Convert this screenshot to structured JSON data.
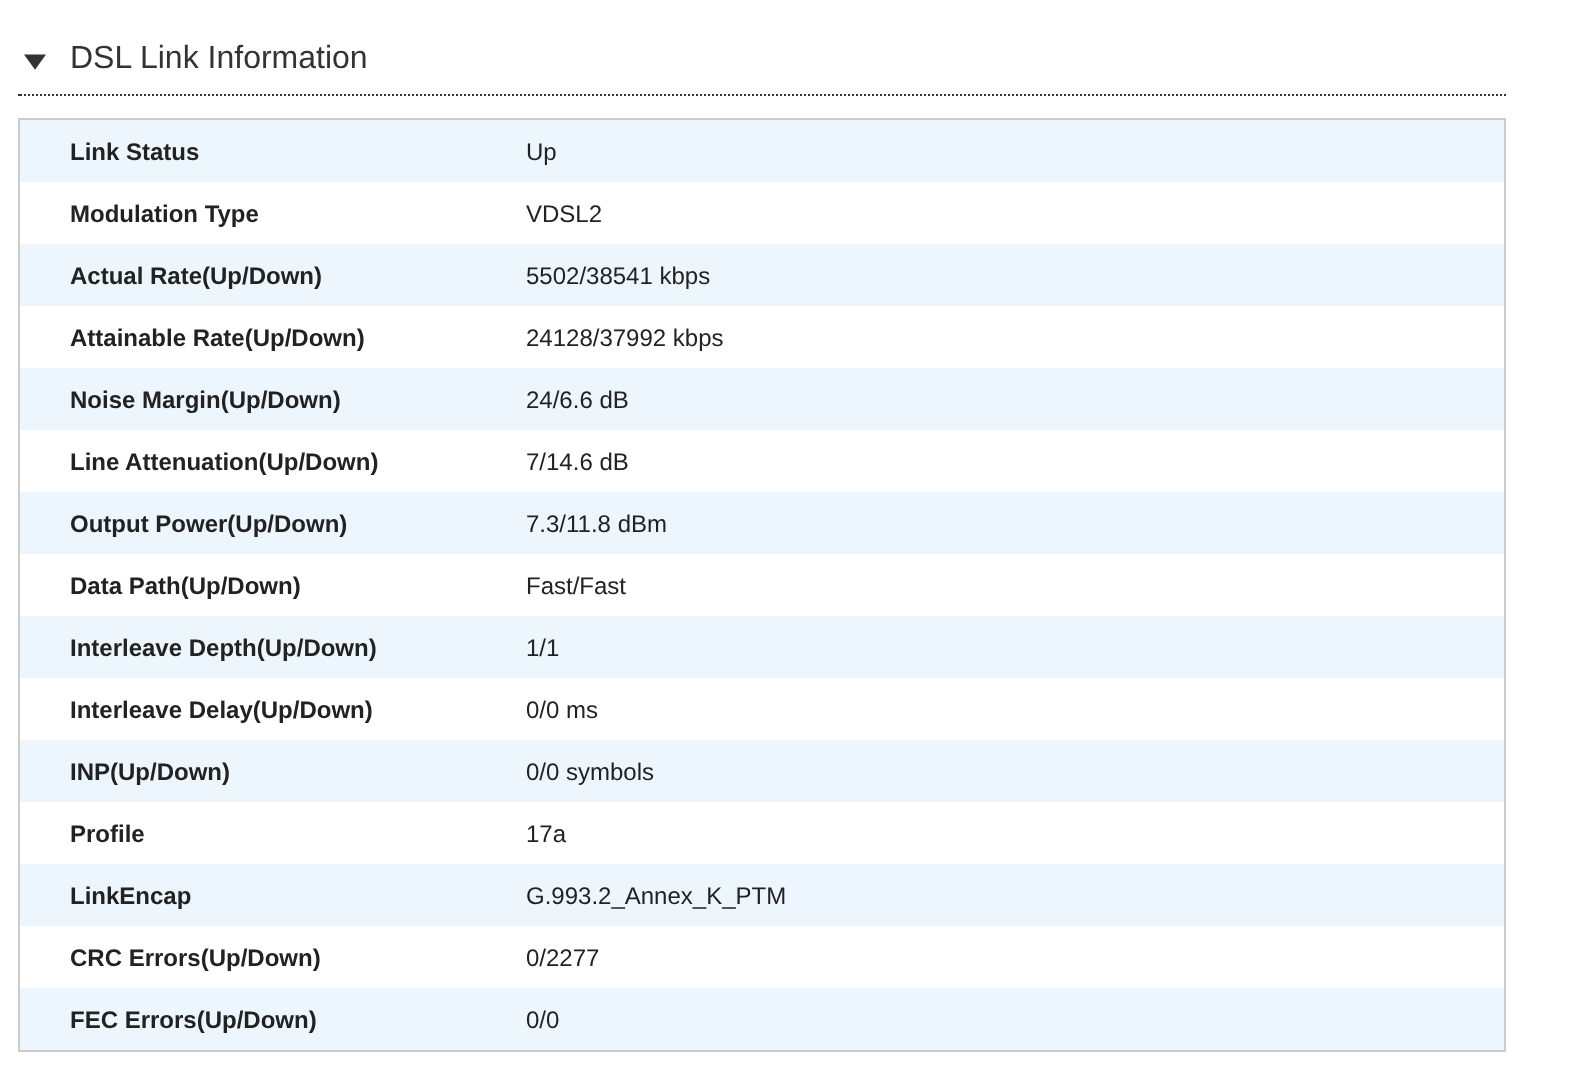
{
  "section": {
    "title": "DSL Link Information",
    "expanded": true
  },
  "rows": [
    {
      "label": "Link Status",
      "value": "Up"
    },
    {
      "label": "Modulation Type",
      "value": "VDSL2"
    },
    {
      "label": "Actual Rate(Up/Down)",
      "value": "5502/38541 kbps"
    },
    {
      "label": "Attainable Rate(Up/Down)",
      "value": "24128/37992 kbps"
    },
    {
      "label": "Noise Margin(Up/Down)",
      "value": "24/6.6 dB"
    },
    {
      "label": "Line Attenuation(Up/Down)",
      "value": "7/14.6 dB"
    },
    {
      "label": "Output Power(Up/Down)",
      "value": "7.3/11.8 dBm"
    },
    {
      "label": "Data Path(Up/Down)",
      "value": "Fast/Fast"
    },
    {
      "label": "Interleave Depth(Up/Down)",
      "value": "1/1"
    },
    {
      "label": "Interleave Delay(Up/Down)",
      "value": "0/0 ms"
    },
    {
      "label": "INP(Up/Down)",
      "value": "0/0 symbols"
    },
    {
      "label": "Profile",
      "value": "17a"
    },
    {
      "label": "LinkEncap",
      "value": "G.993.2_Annex_K_PTM"
    },
    {
      "label": "CRC Errors(Up/Down)",
      "value": "0/2277"
    },
    {
      "label": "FEC Errors(Up/Down)",
      "value": "0/0"
    }
  ]
}
